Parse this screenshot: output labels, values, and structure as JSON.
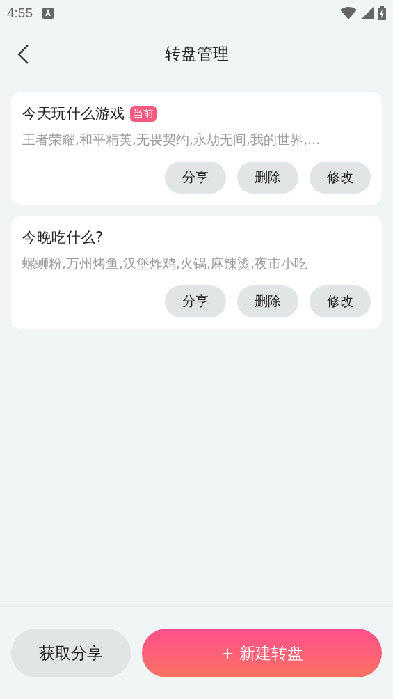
{
  "status_bar": {
    "time": "4:55"
  },
  "header": {
    "title": "转盘管理"
  },
  "wheels": [
    {
      "title": "今天玩什么游戏",
      "badge": "当前",
      "options": "王者荣耀,和平精英,无畏契约,永劫无间,我的世界,...",
      "actions": [
        "分享",
        "删除",
        "修改"
      ]
    },
    {
      "title": "今晚吃什么?",
      "options": "螺蛳粉,万州烤鱼,汉堡炸鸡,火锅,麻辣烫,夜市小吃",
      "actions": [
        "分享",
        "删除",
        "修改"
      ]
    }
  ],
  "footer": {
    "secondary_button": "获取分享",
    "primary_button": "+ 新建转盘"
  }
}
